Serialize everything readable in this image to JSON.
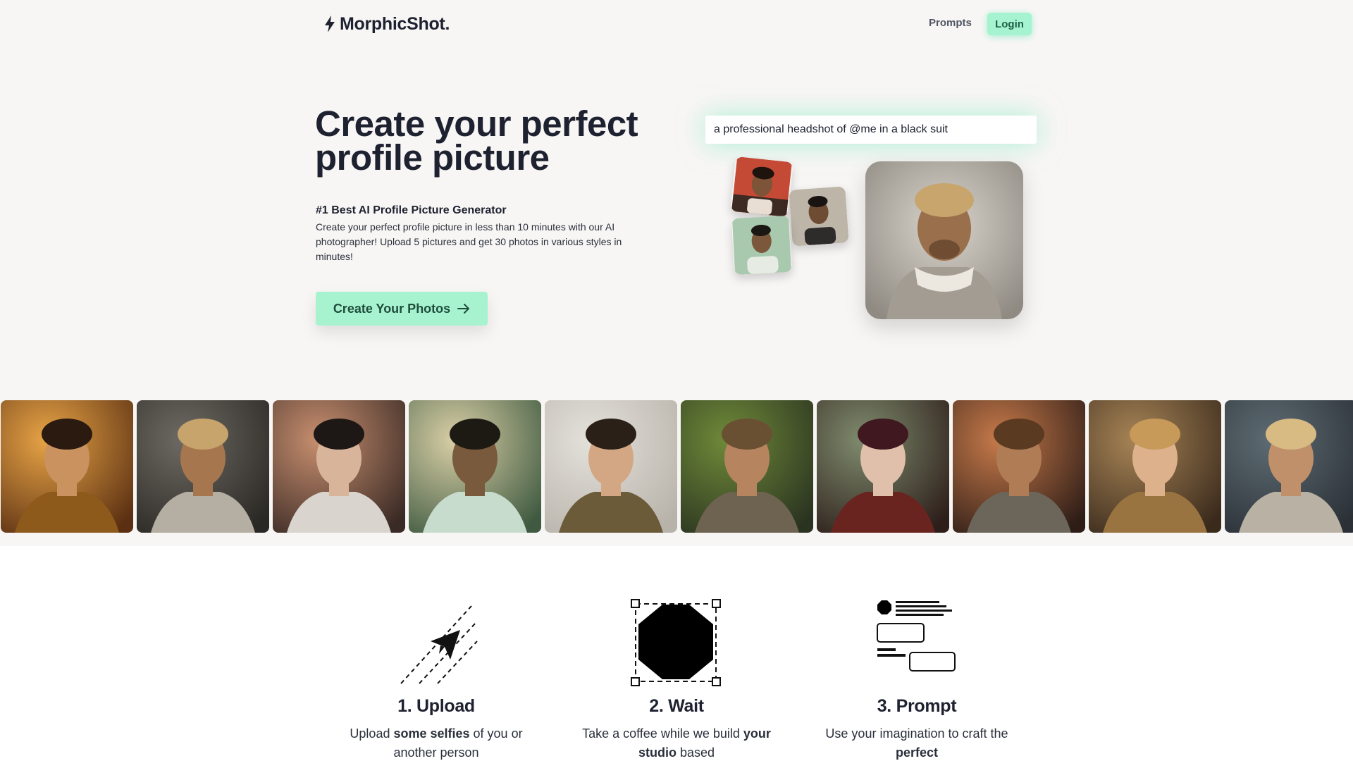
{
  "header": {
    "logo_text": "MorphicShot.",
    "logo_icon": "lightning-bolt-icon",
    "nav": {
      "prompts_label": "Prompts",
      "login_label": "Login"
    }
  },
  "hero": {
    "title": "Create your perfect profile picture",
    "subheading": "#1 Best AI Profile Picture Generator",
    "description": "Create your perfect profile picture in less than 10 minutes with our AI photographer! Upload 5 pictures and get 30 photos in various styles in minutes!",
    "cta_label": "Create Your Photos",
    "cta_icon": "arrow-right-icon"
  },
  "demo": {
    "prompt_value": "a professional headshot of @me in a black suit",
    "selfies": [
      "selfie-red-background",
      "selfie-studio",
      "selfie-green-background"
    ],
    "result": "generated-armor-portrait"
  },
  "gallery": {
    "portraits": [
      {
        "alt": "woman-golden-light-portrait",
        "bg1": "#e8a446",
        "bg2": "#5b3012",
        "skin": "#c9925f",
        "hair": "#2a1a10",
        "cloth": "#8d5a1c"
      },
      {
        "alt": "man-armor-portrait",
        "bg1": "#6e6a63",
        "bg2": "#2a2824",
        "skin": "#a6774f",
        "hair": "#c6a46c",
        "cloth": "#b5aea2"
      },
      {
        "alt": "woman-silver-armor-portrait",
        "bg1": "#c88f6f",
        "bg2": "#3a2a25",
        "skin": "#d8b49a",
        "hair": "#1d1715",
        "cloth": "#d9d4ce"
      },
      {
        "alt": "man-astronaut-portrait",
        "bg1": "#d9cfa7",
        "bg2": "#3f5a40",
        "skin": "#7a5a3c",
        "hair": "#1d1a14",
        "cloth": "#c8dccd"
      },
      {
        "alt": "woman-natural-portrait",
        "bg1": "#e4e1db",
        "bg2": "#b8b3aa",
        "skin": "#d3a784",
        "hair": "#2a2018",
        "cloth": "#6b5b38"
      },
      {
        "alt": "man-closeup-portrait",
        "bg1": "#6f8a39",
        "bg2": "#2a3320",
        "skin": "#b68560",
        "hair": "#6a5032",
        "cloth": "#6e6350"
      },
      {
        "alt": "woman-fantasy-portrait",
        "bg1": "#7f8c6e",
        "bg2": "#2d1e1a",
        "skin": "#e0c0aa",
        "hair": "#3f1820",
        "cloth": "#6a2420"
      },
      {
        "alt": "man-glasses-portrait",
        "bg1": "#c77a4a",
        "bg2": "#2e1d17",
        "skin": "#b07c55",
        "hair": "#5a3a20",
        "cloth": "#6b6659"
      },
      {
        "alt": "woman-golden-armor-portrait",
        "bg1": "#a78456",
        "bg2": "#3a2a1c",
        "skin": "#dcb18c",
        "hair": "#c79a5a",
        "cloth": "#9a7440"
      },
      {
        "alt": "man-curly-hair-portrait",
        "bg1": "#5e6b73",
        "bg2": "#2a3036",
        "skin": "#c0906a",
        "hair": "#d8bb82",
        "cloth": "#b9b2a4"
      }
    ]
  },
  "steps": [
    {
      "icon": "paper-plane-icon",
      "title": "1. Upload",
      "desc_pre": "Upload ",
      "desc_bold": "some selfies",
      "desc_post": " of you or another person"
    },
    {
      "icon": "octagon-selection-icon",
      "title": "2. Wait",
      "desc_pre": "Take a coffee while we build ",
      "desc_bold": "your studio",
      "desc_post": " based"
    },
    {
      "icon": "layout-blocks-icon",
      "title": "3. Prompt",
      "desc_pre": "Use your imagination to craft the ",
      "desc_bold": "perfect",
      "desc_post": ""
    }
  ],
  "colors": {
    "accent": "#a7f3d0",
    "accent_glow": "#6ee7b7",
    "text": "#1e2230",
    "hero_bg": "#f8f6f5"
  }
}
